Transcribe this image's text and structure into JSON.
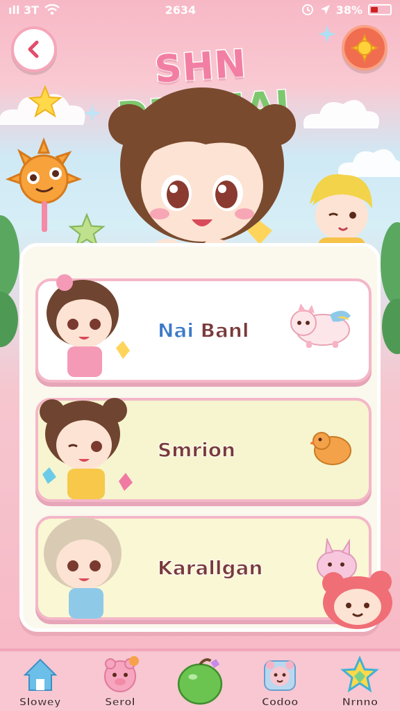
{
  "status_bar": {
    "carrier": "ıll 3T",
    "time": "2634",
    "battery": "38%",
    "battery_level": 0.38
  },
  "header": {
    "title_parts": [
      {
        "text": "SHN",
        "color": "#f27fa3"
      },
      {
        "text": " ",
        "color": "#ffffff"
      },
      {
        "text": "DFEAIAI",
        "color": "#7dc86e"
      }
    ],
    "back_icon": "chevron-left-icon",
    "right_icon": "sun-icon"
  },
  "cards": [
    {
      "name_accent": "Nai",
      "name_rest": " Banl",
      "bg": "#ffffff",
      "pet_icon": "pig-pet-icon"
    },
    {
      "name_accent": "",
      "name_rest": "Smrion",
      "bg": "#f6f5cf",
      "pet_icon": "duck-pet-icon"
    },
    {
      "name_accent": "",
      "name_rest": "Karallgan",
      "bg": "#f9f7d4",
      "pet_icon": "bunny-pet-icon"
    }
  ],
  "nav": [
    {
      "label": "Slowey",
      "icon": "house-icon"
    },
    {
      "label": "Serol",
      "icon": "pig-icon"
    },
    {
      "label": "",
      "icon": "apple-icon"
    },
    {
      "label": "Codoo",
      "icon": "bear-icon"
    },
    {
      "label": "Nrnno",
      "icon": "star-icon"
    }
  ]
}
